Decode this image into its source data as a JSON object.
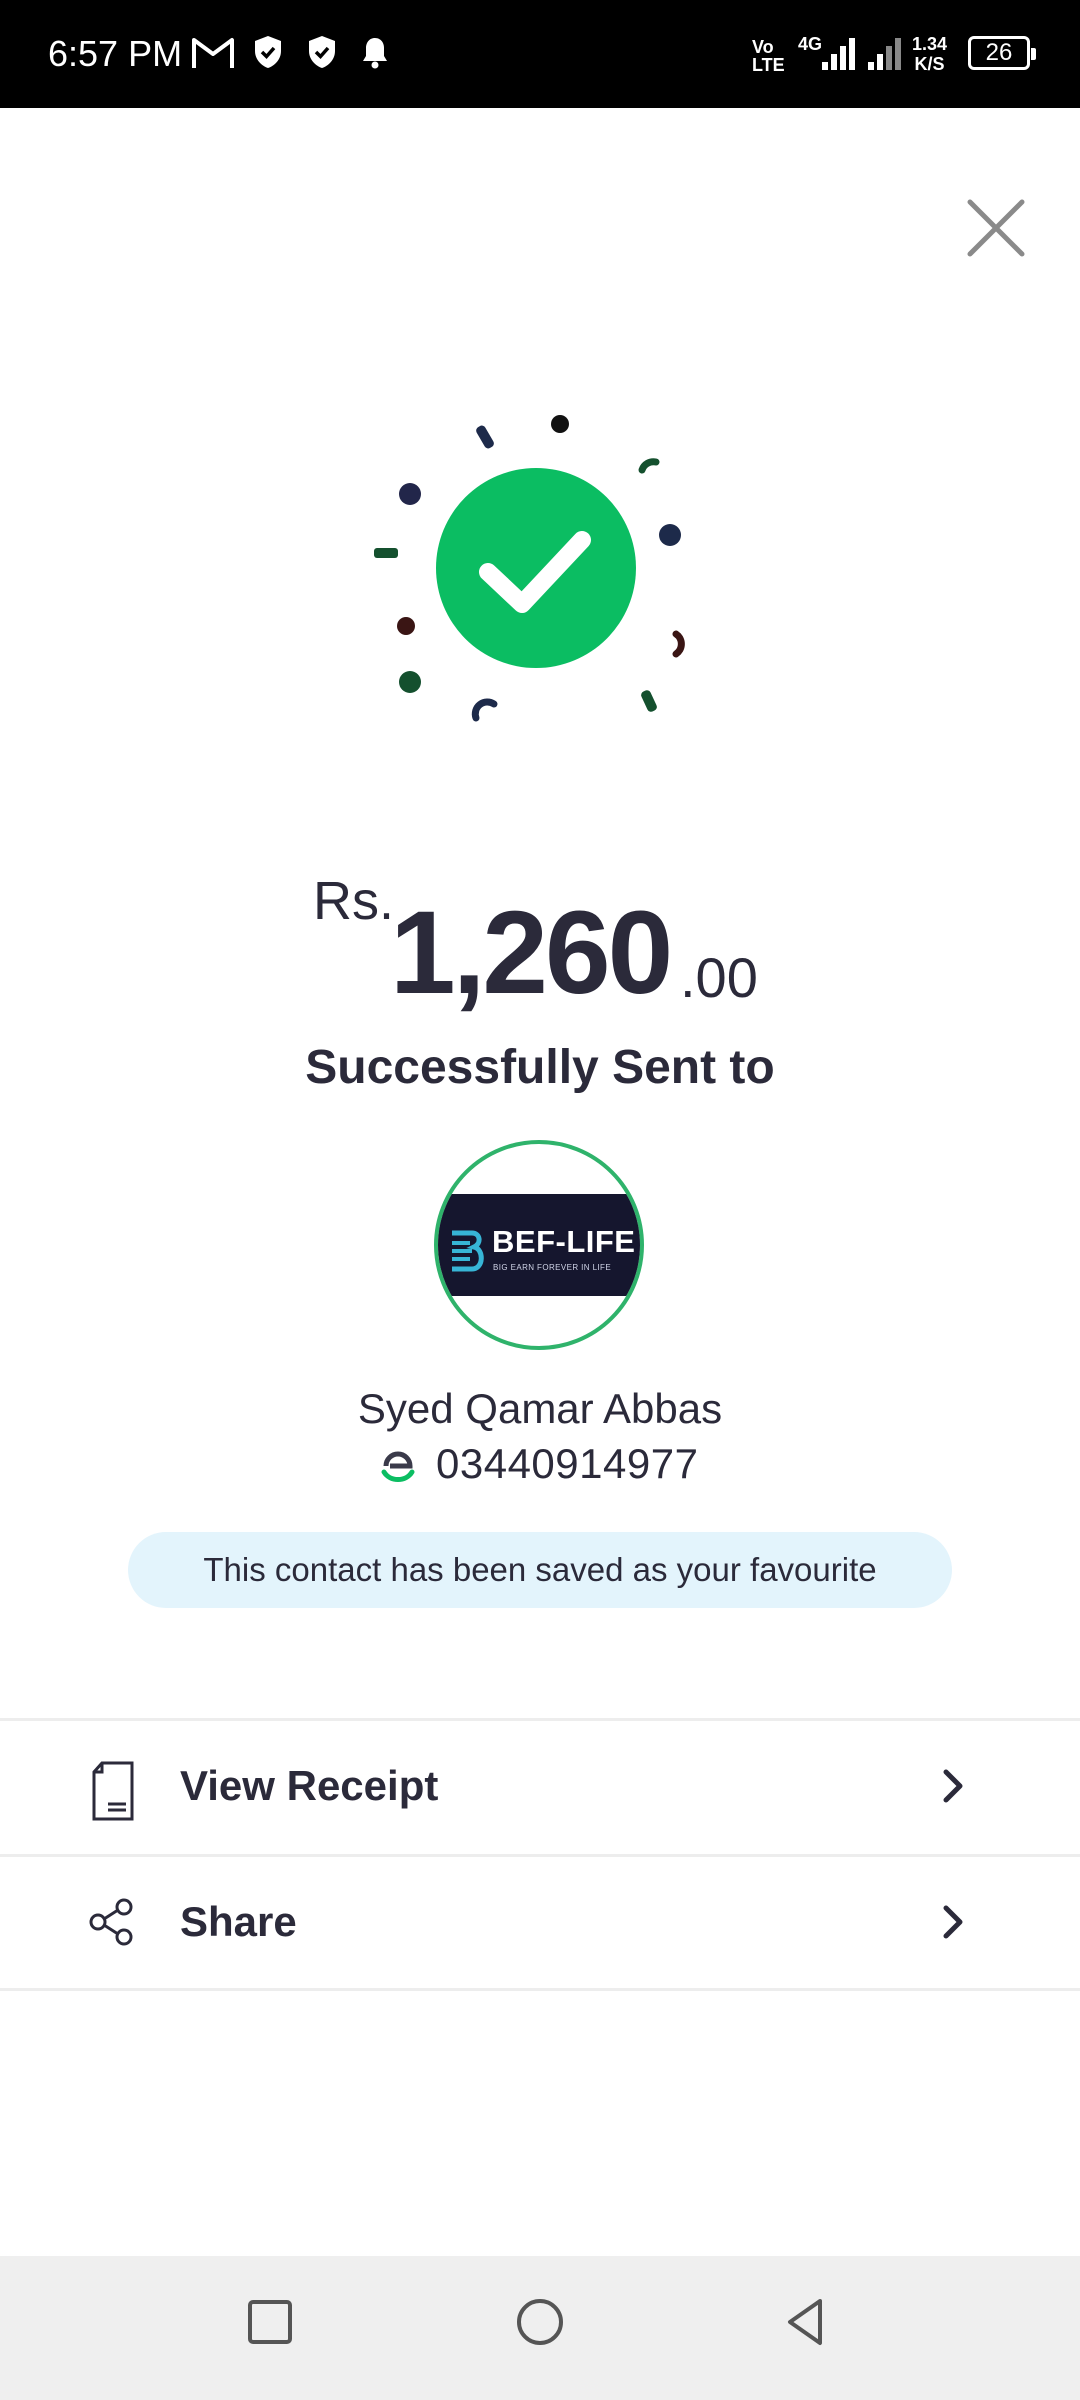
{
  "status_bar": {
    "time": "6:57 PM",
    "volte": "Vo\nLTE",
    "network": "4G",
    "speed_value": "1.34",
    "speed_unit": "K/S",
    "battery": "26"
  },
  "close": {
    "icon": "close-icon"
  },
  "amount": {
    "currency": "Rs.",
    "main": "1,260",
    "decimal": ".00"
  },
  "sent_title": "Successfully Sent to",
  "contact": {
    "avatar_logo_text": "BEF-LIFE",
    "avatar_logo_sub": "BIG EARN FOREVER IN LIFE",
    "name": "Syed Qamar Abbas",
    "phone": "03440914977"
  },
  "favourite_banner": "This contact has been saved as your favourite",
  "actions": [
    {
      "label": "View Receipt",
      "icon": "receipt-icon"
    },
    {
      "label": "Share",
      "icon": "share-icon"
    }
  ],
  "colors": {
    "success_green": "#0bbd62",
    "text_dark": "#2b2a3a",
    "banner_bg": "#e3f4fc",
    "avatar_border": "#2fb36b"
  }
}
